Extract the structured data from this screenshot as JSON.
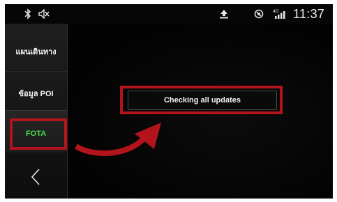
{
  "statusbar": {
    "icons": [
      "bluetooth-icon",
      "speaker-mute-icon",
      "upload-icon",
      "nfc-icon",
      "signal-4g-icon"
    ],
    "signal_label": "4G",
    "time": "11:37"
  },
  "sidebar": {
    "items": [
      {
        "label": "แผนเดินทาง"
      },
      {
        "label": "ข้อมูล POI"
      },
      {
        "label": "FOTA",
        "selected": true
      }
    ],
    "back_icon": "chevron-left-icon"
  },
  "main": {
    "check_button_label": "Checking all updates"
  },
  "annotations": {
    "highlight_color": "#b3141b",
    "arrow": "curved-arrow-icon"
  },
  "colors": {
    "selected_text": "#49d84a",
    "background": "#050505"
  }
}
